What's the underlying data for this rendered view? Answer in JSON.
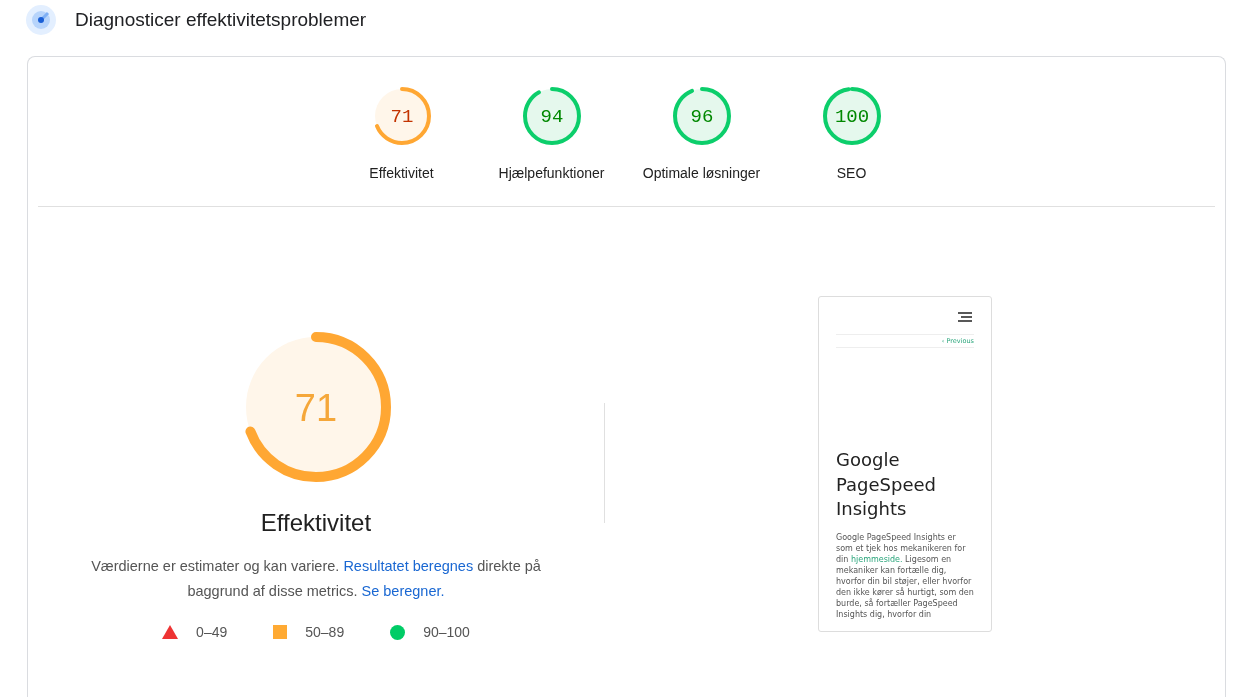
{
  "header": {
    "title": "Diagnosticer effektivitetsproblemer"
  },
  "scores": [
    {
      "score": "71",
      "label": "Effektivitet"
    },
    {
      "score": "94",
      "label": "Hjælpefunktioner"
    },
    {
      "score": "96",
      "label": "Optimale løsninger"
    },
    {
      "score": "100",
      "label": "SEO"
    }
  ],
  "summary": {
    "score": "71",
    "title": "Effektivitet",
    "description": [
      {
        "kind": "text",
        "text": "Værdierne er estimater og kan variere. "
      },
      {
        "kind": "link",
        "text": "Resultatet beregnes"
      },
      {
        "kind": "text",
        "text": " direkte på baggrund af disse metrics. "
      },
      {
        "kind": "link",
        "text": "Se beregner."
      }
    ]
  },
  "legend": [
    {
      "kind": "triangle",
      "color": "#ee3333",
      "range": "0–49"
    },
    {
      "kind": "square",
      "color": "#ffaa33",
      "range": "50–89"
    },
    {
      "kind": "circle",
      "color": "#00cc66",
      "range": "90–100"
    }
  ],
  "screenshot": {
    "nav_link": "‹ Previous",
    "heading": "Google PageSpeed Insights",
    "body": [
      {
        "kind": "text",
        "text": "Google PageSpeed Insights er som et tjek hos mekanikeren for din "
      },
      {
        "kind": "link",
        "text": "hjemmeside."
      },
      {
        "kind": "text",
        "text": " Ligesom en mekaniker kan fortælle dig, hvorfor din bil støjer, eller hvorfor den ikke kører så hurtigt, som den burde, så fortæller PageSpeed Insights dig, hvorfor din"
      }
    ]
  }
}
